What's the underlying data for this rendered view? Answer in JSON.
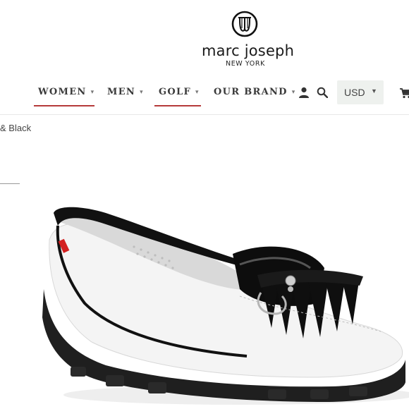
{
  "brand": {
    "name": "marc joseph",
    "location": "NEW YORK"
  },
  "nav": {
    "items": [
      {
        "label": "WOMEN",
        "active": true
      },
      {
        "label": "MEN",
        "active": false
      },
      {
        "label": "GOLF",
        "active": true
      },
      {
        "label": "OUR BRAND",
        "active": false
      }
    ]
  },
  "header": {
    "currency": "USD",
    "icons": [
      "account-icon",
      "search-icon",
      "cart-icon"
    ]
  },
  "breadcrumb": {
    "text": "& Black"
  },
  "colors": {
    "accent": "#b53a3a",
    "currency_bg": "#eef1ee",
    "text": "#3a3a3a"
  }
}
